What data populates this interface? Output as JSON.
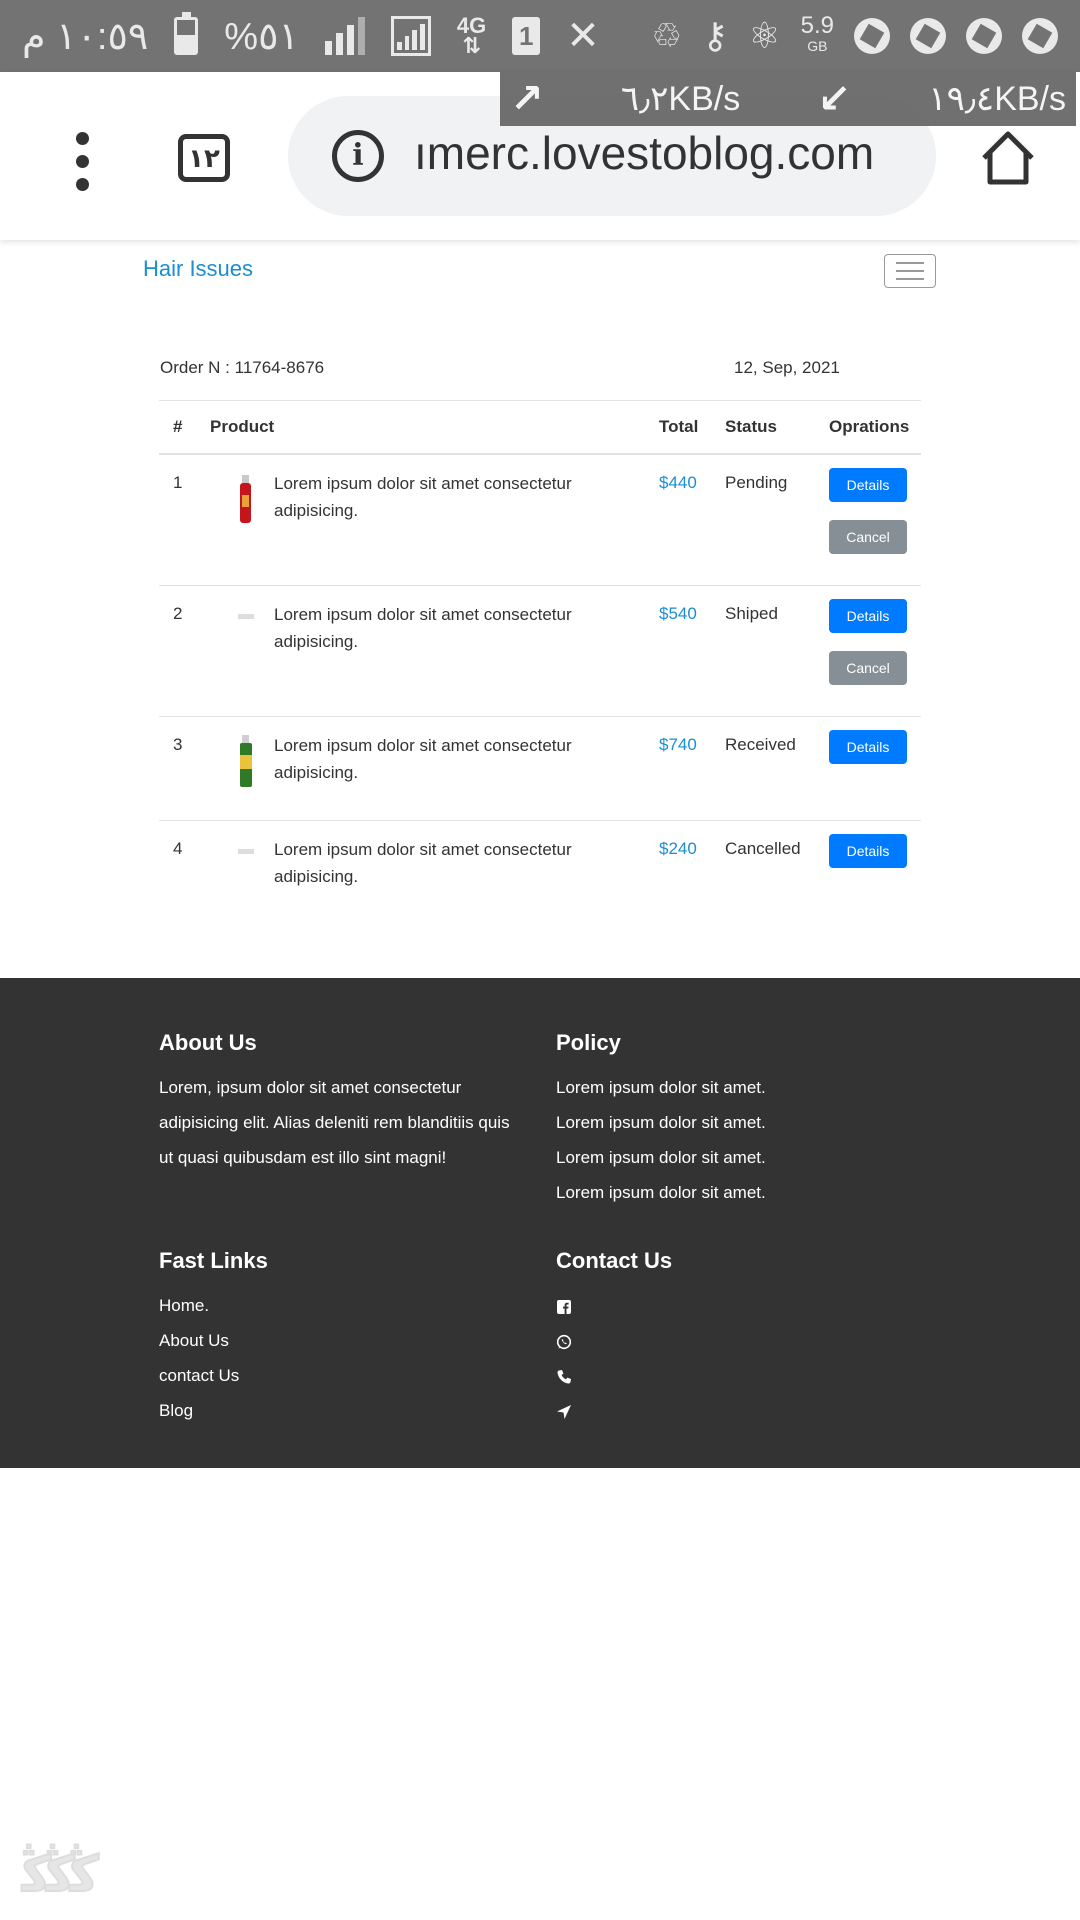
{
  "status_bar": {
    "time": "١٠:٥٩ م",
    "battery": "%٥١",
    "network": "4G",
    "sim": "1",
    "storage_value": "5.9",
    "storage_unit": "GB"
  },
  "browser": {
    "tab_count": "١٢",
    "url": "ımerc.lovestoblog.com",
    "upload_speed": "٦٫٢KB/s",
    "download_speed": "١٩٫٤KB/s"
  },
  "site": {
    "brand": "Hair Issues"
  },
  "order": {
    "number_label": "Order N : 11764-8676",
    "date": "12, Sep, 2021",
    "columns": [
      "#",
      "Product",
      "Total",
      "Status",
      "Oprations"
    ],
    "rows": [
      {
        "index": "1",
        "product": "Lorem ipsum dolor sit amet consectetur adipisicing.",
        "total": "$440",
        "status": "Pending",
        "details": "Details",
        "cancel": "Cancel"
      },
      {
        "index": "2",
        "product": "Lorem ipsum dolor sit amet consectetur adipisicing.",
        "total": "$540",
        "status": "Shiped",
        "details": "Details",
        "cancel": "Cancel"
      },
      {
        "index": "3",
        "product": "Lorem ipsum dolor sit amet consectetur adipisicing.",
        "total": "$740",
        "status": "Received",
        "details": "Details"
      },
      {
        "index": "4",
        "product": "Lorem ipsum dolor sit amet consectetur adipisicing.",
        "total": "$240",
        "status": "Cancelled",
        "details": "Details"
      }
    ]
  },
  "footer": {
    "about": {
      "title": "About Us",
      "text": "Lorem, ipsum dolor sit amet consectetur adipisicing elit. Alias deleniti rem blanditiis quis ut quasi quibusdam est illo sint magni!"
    },
    "policy": {
      "title": "Policy",
      "items": [
        "Lorem ipsum dolor sit amet.",
        "Lorem ipsum dolor sit amet.",
        "Lorem ipsum dolor sit amet.",
        "Lorem ipsum dolor sit amet."
      ]
    },
    "fast_links": {
      "title": "Fast Links",
      "items": [
        "Home.",
        "About Us",
        "contact Us",
        "Blog"
      ]
    },
    "contact": {
      "title": "Contact Us",
      "icons": [
        "facebook-icon",
        "whatsapp-icon",
        "phone-icon",
        "location-arrow-icon"
      ]
    }
  },
  "colors": {
    "link_blue": "#1a8ed2",
    "primary_button": "#007bff",
    "secondary_button": "#868e96",
    "footer_bg": "#333333",
    "status_bar_bg": "#737373"
  }
}
